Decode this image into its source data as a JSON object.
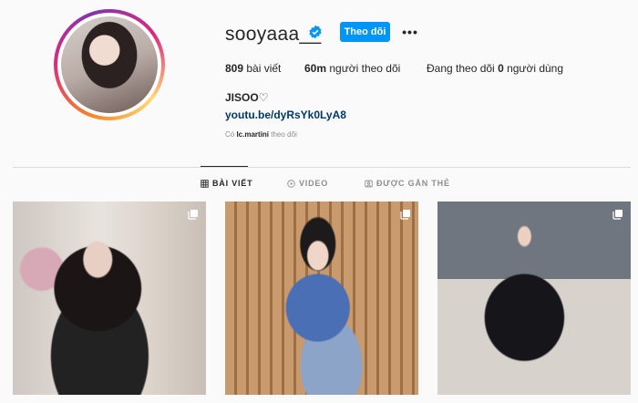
{
  "profile": {
    "username": "sooyaaa__",
    "follow_label": "Theo dõi",
    "more_label": "•••",
    "posts_count": "809",
    "posts_label": " bài viết",
    "followers_count": "60m",
    "followers_label": " người theo dõi",
    "following_prefix": "Đang theo dõi ",
    "following_count": "0",
    "following_label": " người dùng",
    "full_name": "JISOO♡",
    "link": "youtu.be/dyRsYk0LyA8",
    "followed_by_prefix": "Có ",
    "followed_by_user": "lc.martini",
    "followed_by_suffix": " theo dõi"
  },
  "tabs": [
    {
      "label": "BÀI VIẾT",
      "icon": "grid-icon",
      "active": true
    },
    {
      "label": "VIDEO",
      "icon": "play-icon",
      "active": false
    },
    {
      "label": "ĐƯỢC GẮN THẺ",
      "icon": "tag-icon",
      "active": false
    }
  ],
  "posts": [
    {
      "icon": "multiple-photos-icon"
    },
    {
      "icon": "multiple-photos-icon"
    },
    {
      "icon": "multiple-photos-icon"
    }
  ],
  "colors": {
    "accent": "#0095f6",
    "link": "#00376b",
    "muted": "#8e8e8e"
  }
}
